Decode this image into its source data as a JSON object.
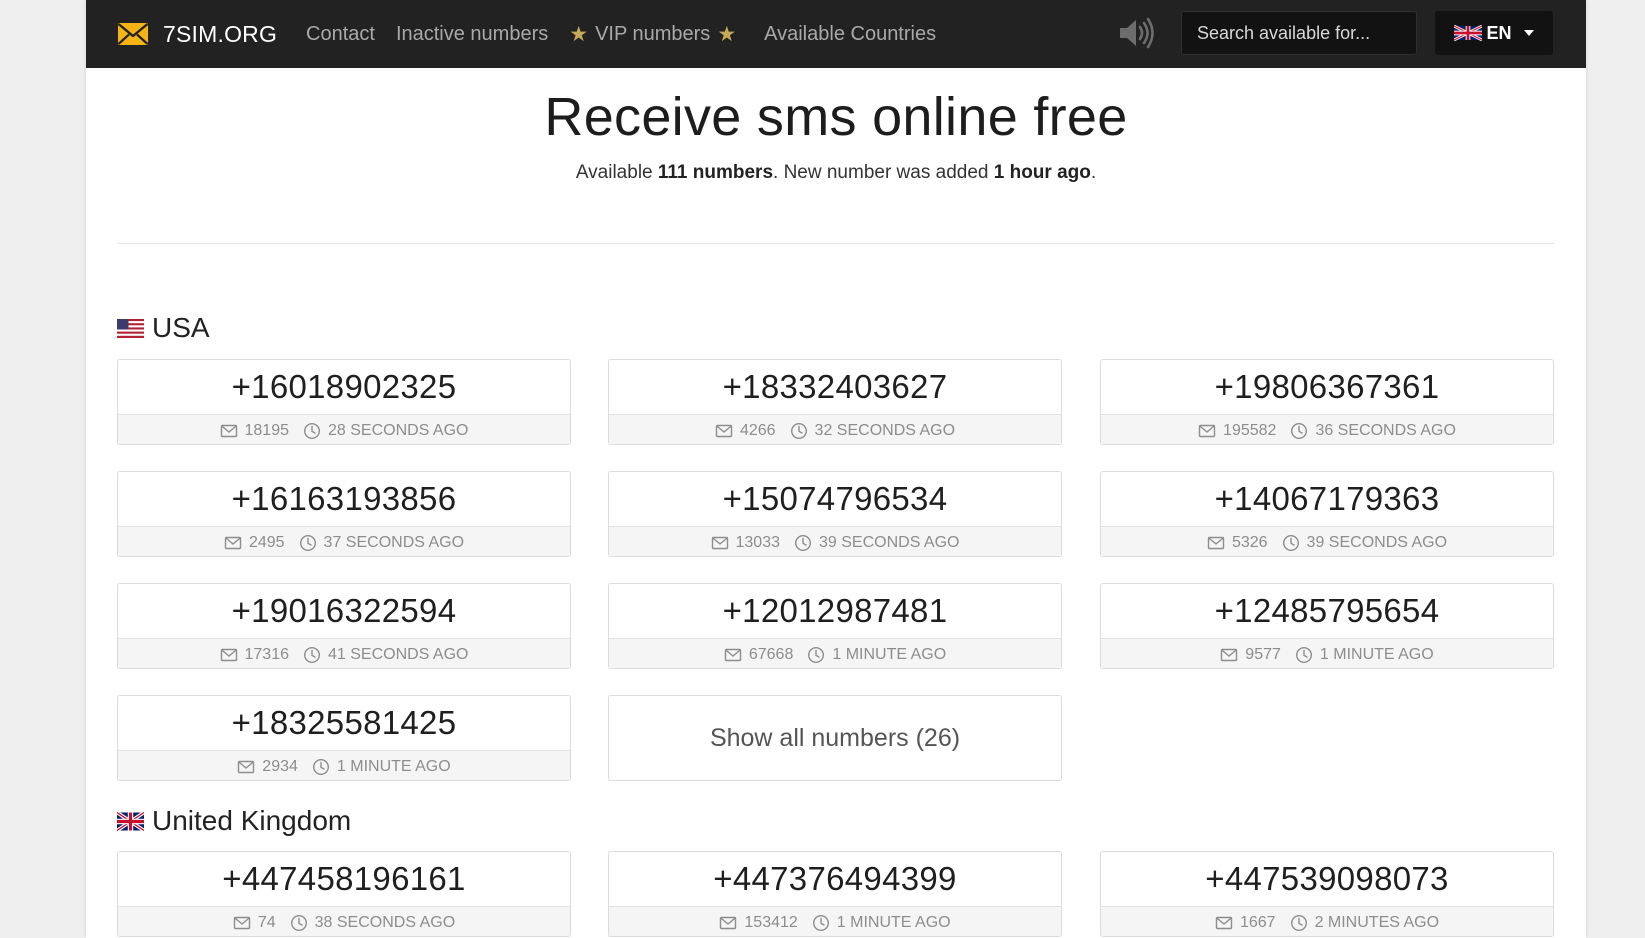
{
  "brand": {
    "name": "7SIM.ORG"
  },
  "nav": [
    {
      "label": "Contact"
    },
    {
      "label": "Inactive numbers"
    },
    {
      "label": "VIP numbers",
      "decorated": true
    },
    {
      "label": "Available Countries"
    }
  ],
  "search": {
    "placeholder": "Search available for..."
  },
  "language": {
    "code": "EN"
  },
  "hero": {
    "title": "Receive sms online free",
    "sub_prefix": "Available ",
    "count": "111 numbers",
    "sub_middle": ". New number was added ",
    "added": "1 hour ago",
    "sub_suffix": "."
  },
  "countries": [
    {
      "name": "USA",
      "flag": "us-flag-icon",
      "numbers": [
        {
          "phone": "+16018902325",
          "messages": "18195",
          "time": "28 seconds ago"
        },
        {
          "phone": "+18332403627",
          "messages": "4266",
          "time": "32 seconds ago"
        },
        {
          "phone": "+19806367361",
          "messages": "195582",
          "time": "36 seconds ago"
        },
        {
          "phone": "+16163193856",
          "messages": "2495",
          "time": "37 seconds ago"
        },
        {
          "phone": "+15074796534",
          "messages": "13033",
          "time": "39 seconds ago"
        },
        {
          "phone": "+14067179363",
          "messages": "5326",
          "time": "39 seconds ago"
        },
        {
          "phone": "+19016322594",
          "messages": "17316",
          "time": "41 seconds ago"
        },
        {
          "phone": "+12012987481",
          "messages": "67668",
          "time": "1 minute ago"
        },
        {
          "phone": "+12485795654",
          "messages": "9577",
          "time": "1 minute ago"
        },
        {
          "phone": "+18325581425",
          "messages": "2934",
          "time": "1 minute ago"
        }
      ],
      "show_all": "Show all numbers (26)"
    },
    {
      "name": "United Kingdom",
      "flag": "uk-flag-icon",
      "numbers": [
        {
          "phone": "+447458196161",
          "messages": "74",
          "time": "38 seconds ago"
        },
        {
          "phone": "+447376494399",
          "messages": "153412",
          "time": "1 minute ago"
        },
        {
          "phone": "+447539098073",
          "messages": "1667",
          "time": "2 minutes ago"
        }
      ]
    }
  ],
  "colors": {
    "navbar": "#222222",
    "nav_link": "#a9a9a9",
    "star": "#c6a85a",
    "brand_icon": "#f5b316",
    "card_footer": "#f5f5f5"
  }
}
